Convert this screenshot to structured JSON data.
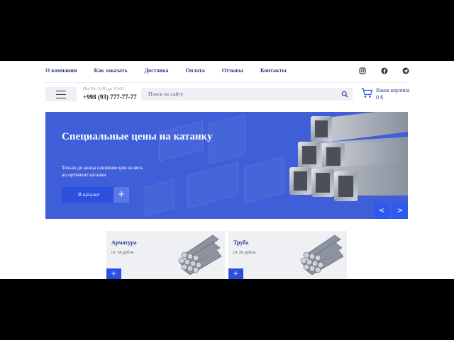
{
  "nav": {
    "items": [
      "О компании",
      "Как заказать",
      "Доставка",
      "Оплата",
      "Отзывы",
      "Контакты"
    ],
    "social": [
      "instagram-icon",
      "facebook-icon",
      "telegram-icon"
    ]
  },
  "header": {
    "menu_icon": "hamburger-icon",
    "hours": "Пн-Пт: 9:00 до 19:00",
    "phone": "+998 (93) 777-77-77",
    "search_placeholder": "Поиск по сайту",
    "cart_label": "Ваша корзина",
    "cart_total": "0 $"
  },
  "hero": {
    "title": "Специальные цены на катанку",
    "subtitle": "Только до конца снижение цен на весь ассортимент катанки",
    "button_label": "В каталог",
    "button_plus": "+",
    "prev": "<",
    "next": ">"
  },
  "products": [
    {
      "name": "Арматура",
      "price": "от 14 руб/м",
      "add": "+"
    },
    {
      "name": "Труба",
      "price": "от 20 руб/м",
      "add": "+"
    }
  ],
  "colors": {
    "accent": "#2d4fe0",
    "nav_text": "#2b3a8f",
    "hero_bg": "#3f5fd8"
  }
}
